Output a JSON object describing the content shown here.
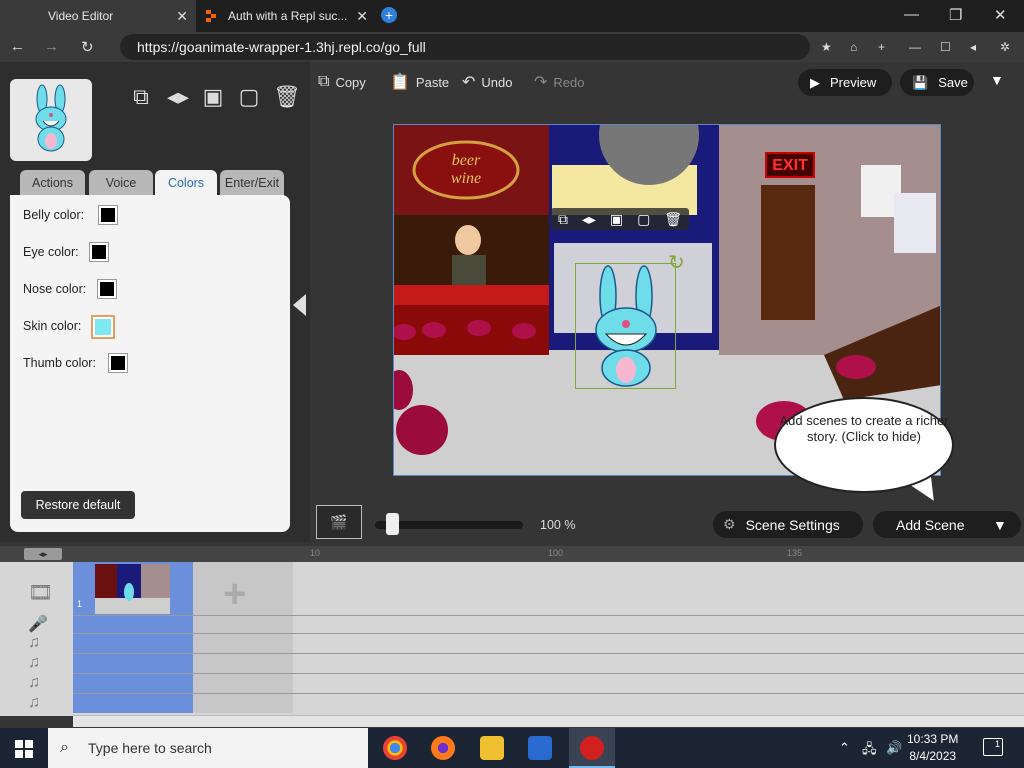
{
  "browser": {
    "tabs": [
      {
        "label": "Video Editor",
        "active": true
      },
      {
        "label": "Auth with a Repl suc...",
        "active": false
      }
    ],
    "url": "https://goanimate-wrapper-1.3hj.repl.co/go_full"
  },
  "left_panel": {
    "tabs": [
      "Actions",
      "Voice",
      "Colors",
      "Enter/Exit"
    ],
    "selected_tab": "Colors",
    "color_rows": [
      {
        "label": "Belly color:",
        "color": "#000000"
      },
      {
        "label": "Eye color:",
        "color": "#000000"
      },
      {
        "label": "Nose color:",
        "color": "#000000"
      },
      {
        "label": "Skin color:",
        "color": "#7ee8f0"
      },
      {
        "label": "Thumb color:",
        "color": "#000000"
      }
    ],
    "restore_label": "Restore default"
  },
  "toolbar": {
    "copy": "Copy",
    "paste": "Paste",
    "undo": "Undo",
    "redo": "Redo",
    "preview": "Preview",
    "save": "Save"
  },
  "stage": {
    "bubble_text": "Add scenes to create a richer story. (Click to hide)"
  },
  "controls": {
    "zoom": "100 %",
    "scene_settings": "Scene Settings",
    "add_scene": "Add Scene"
  },
  "timeline": {
    "ticks": [
      "10",
      "100",
      "135"
    ],
    "scene_number": "1"
  },
  "taskbar": {
    "search_placeholder": "Type here to search",
    "time": "10:33 PM",
    "date": "8/4/2023",
    "notification_count": "1"
  },
  "colors": {
    "accent": "#2b6db5",
    "timeline_scene": "#6b8fda",
    "selection": "#7fa83a"
  }
}
